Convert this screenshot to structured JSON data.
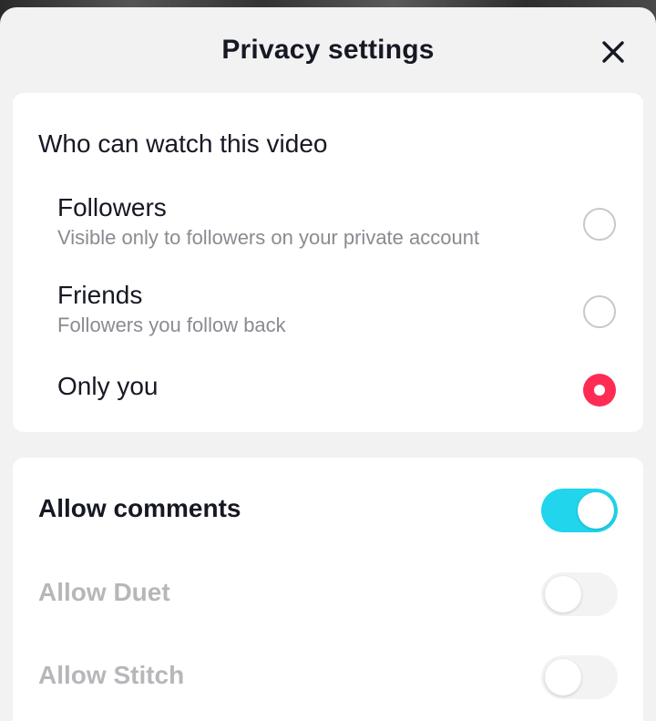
{
  "header": {
    "title": "Privacy settings",
    "close_icon": "close-icon"
  },
  "visibility": {
    "title": "Who can watch this video",
    "options": [
      {
        "label": "Followers",
        "sublabel": "Visible only to followers on your private account",
        "selected": false
      },
      {
        "label": "Friends",
        "sublabel": "Followers you follow back",
        "selected": false
      },
      {
        "label": "Only you",
        "sublabel": "",
        "selected": true
      }
    ]
  },
  "interactions": {
    "toggles": [
      {
        "label": "Allow comments",
        "on": true,
        "enabled": true
      },
      {
        "label": "Allow Duet",
        "on": false,
        "enabled": false
      },
      {
        "label": "Allow Stitch",
        "on": false,
        "enabled": false
      }
    ]
  },
  "colors": {
    "accent_selected": "#fe2c55",
    "toggle_on": "#20d5ec",
    "sheet_bg": "#f2f2f2",
    "card_bg": "#ffffff"
  }
}
